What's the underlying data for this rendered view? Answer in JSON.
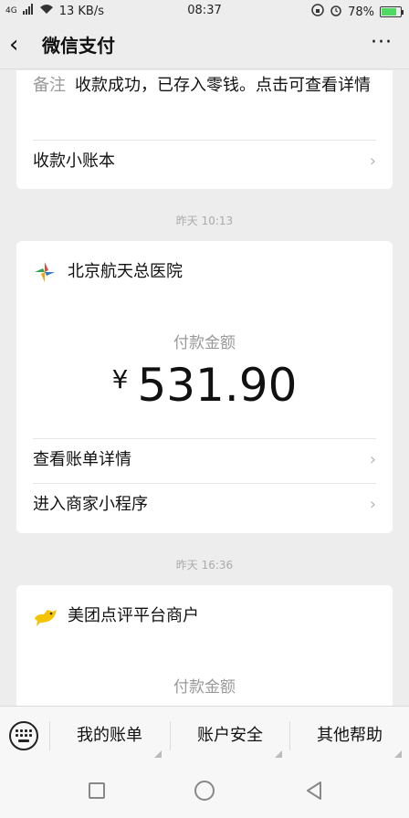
{
  "status_bar": {
    "signal": "4G",
    "net_speed": "13 KB/s",
    "time": "08:37",
    "battery": "78%",
    "battery_level": 0.78
  },
  "nav": {
    "back_glyph": "‹",
    "title": "微信支付",
    "more_glyph": "···"
  },
  "card1": {
    "remark_key": "备注",
    "remark_value": "收款成功，已存入零钱。点击可查看详情",
    "link_label": "收款小账本"
  },
  "timestamp1": "昨天 10:13",
  "card2": {
    "merchant_name": "北京航天总医院",
    "pay_label": "付款金额",
    "currency": "¥",
    "amount": "531.90",
    "link1_label": "查看账单详情",
    "link2_label": "进入商家小程序"
  },
  "timestamp2": "昨天 16:36",
  "card3": {
    "merchant_name": "美团点评平台商户",
    "pay_label": "付款金额"
  },
  "bottom_tabs": [
    {
      "label": "我的账单"
    },
    {
      "label": "账户安全"
    },
    {
      "label": "其他帮助"
    }
  ],
  "colors": {
    "background": "#ededed",
    "card": "#ffffff",
    "meituan_yellow": "#f5c300"
  }
}
